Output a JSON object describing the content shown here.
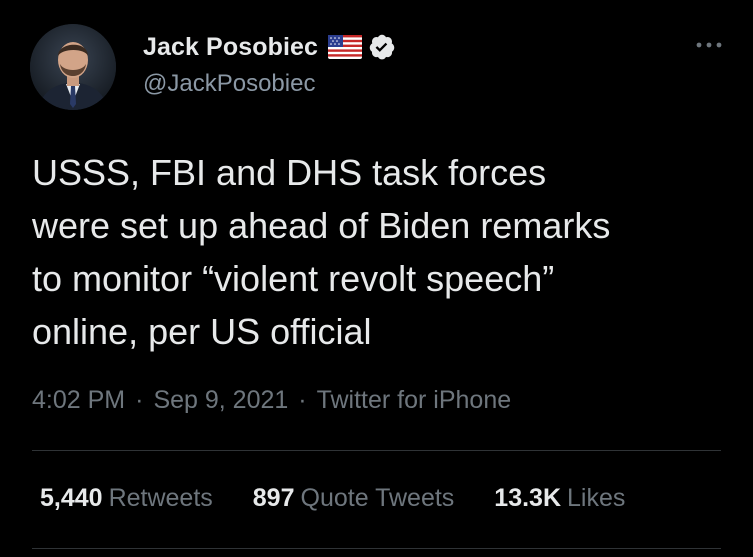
{
  "author": {
    "display_name": "Jack Posobiec",
    "handle": "@JackPosobiec",
    "flag": "us-flag-icon",
    "verified": "verified-badge-icon"
  },
  "tweet": {
    "text": "USSS, FBI and DHS task forces\nwere set up ahead of Biden remarks\nto monitor “violent revolt speech”\nonline, per US official"
  },
  "meta": {
    "time": "4:02 PM",
    "separator": "·",
    "date": "Sep 9, 2021",
    "source": "Twitter for iPhone"
  },
  "stats": {
    "retweets_count": "5,440",
    "retweets_label": "Retweets",
    "quotes_count": "897",
    "quotes_label": "Quote Tweets",
    "likes_count": "13.3K",
    "likes_label": "Likes"
  },
  "colors": {
    "background": "#000000",
    "text_primary": "#e7e9ea",
    "text_secondary": "#6e767d",
    "divider": "#2f3336"
  }
}
